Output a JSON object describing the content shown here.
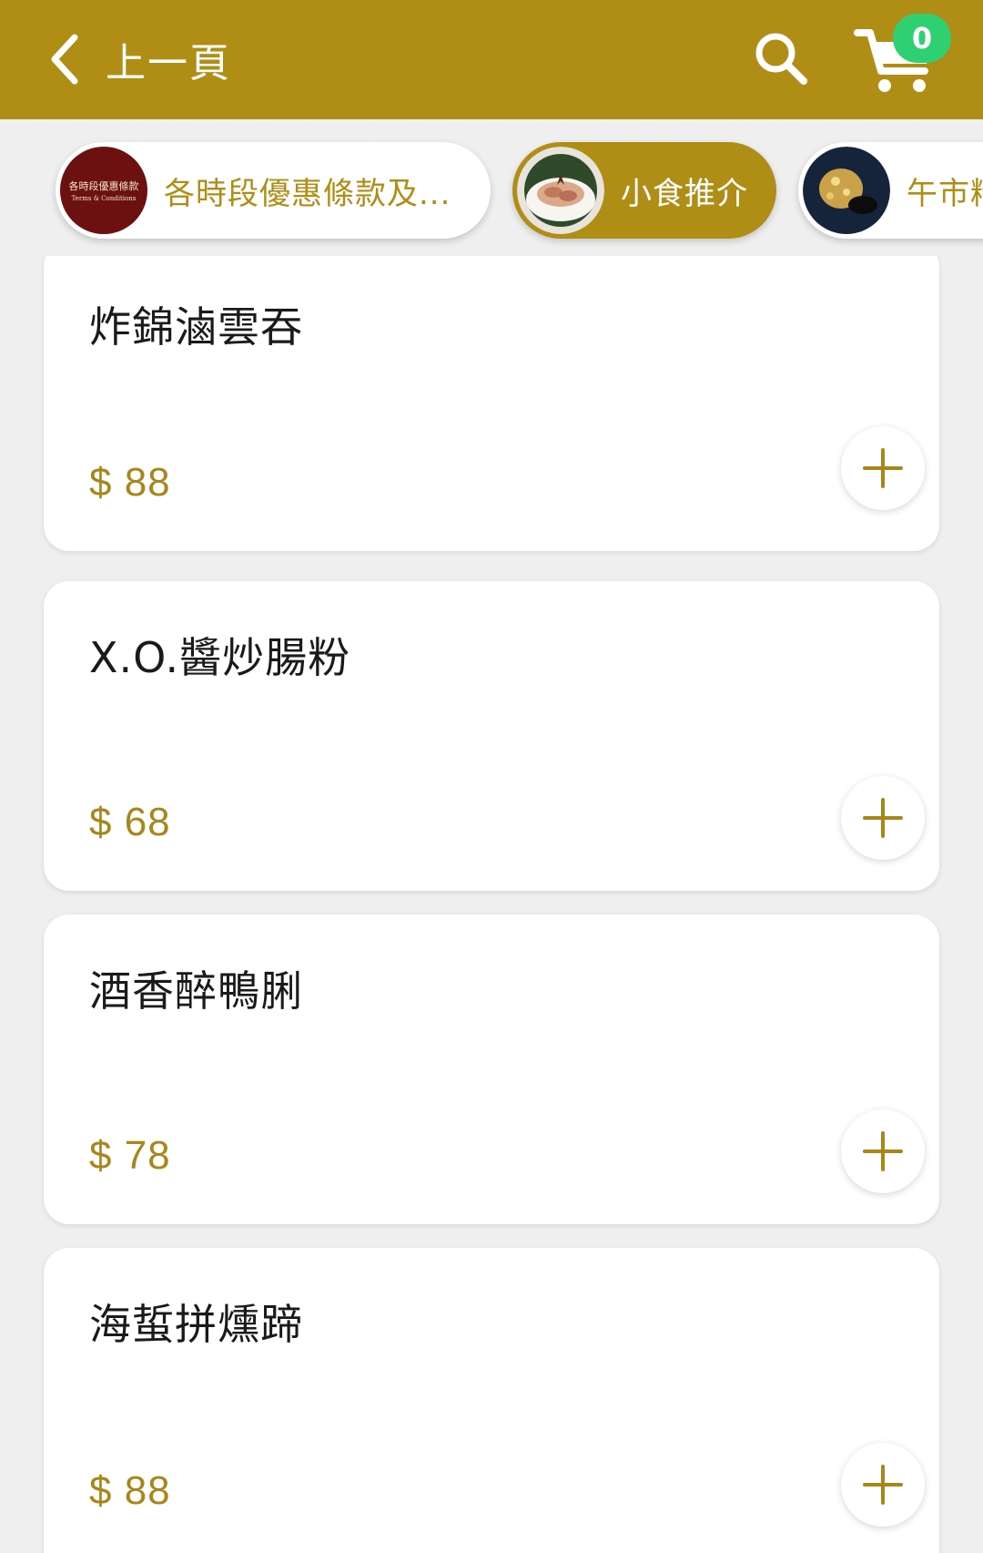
{
  "header": {
    "back_label": "上一頁",
    "back_icon": "chevron-left-icon",
    "search_icon": "search-icon",
    "cart_icon": "cart-icon",
    "cart_count": "0"
  },
  "categories": [
    {
      "label": "各時段優惠條款及...",
      "thumb_text": "各時段優惠條款",
      "thumb_subtext": "Terms & Conditions",
      "active": false
    },
    {
      "label": "小食推介",
      "active": true
    },
    {
      "label": "午市精",
      "active": false
    }
  ],
  "menu_items": [
    {
      "name": "炸錦滷雲吞",
      "price": "$ 88"
    },
    {
      "name": "X.O.醬炒腸粉",
      "price": "$ 68"
    },
    {
      "name": "酒香醉鴨脷",
      "price": "$ 78"
    },
    {
      "name": "海蜇拼燻蹄",
      "price": "$ 88"
    }
  ],
  "colors": {
    "brand": "#b08e16",
    "price": "#a8861a",
    "badge": "#2fd072",
    "background": "#f0eff0"
  }
}
